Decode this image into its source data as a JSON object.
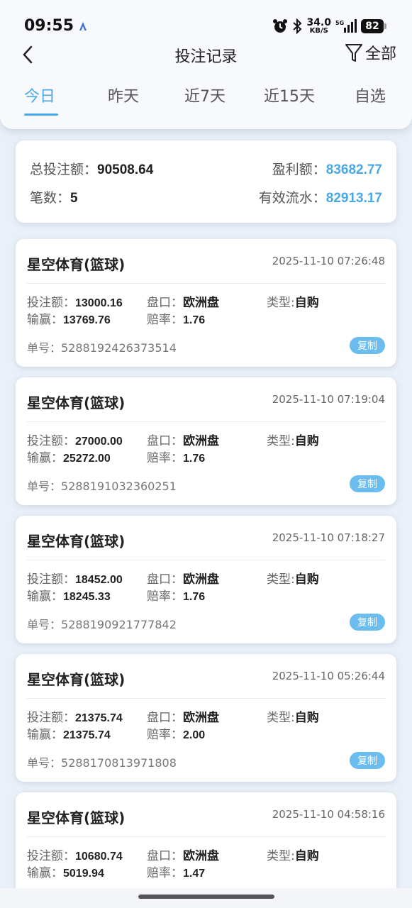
{
  "status_bar": {
    "time": "09:55",
    "net_speed": "34.0",
    "net_unit": "KB/S",
    "battery": "82"
  },
  "nav": {
    "title": "投注记录",
    "filter_label": "全部"
  },
  "tabs": [
    {
      "label": "今日",
      "active": true
    },
    {
      "label": "昨天",
      "active": false
    },
    {
      "label": "近7天",
      "active": false
    },
    {
      "label": "近15天",
      "active": false
    },
    {
      "label": "自选",
      "active": false
    }
  ],
  "summary": {
    "total_bet_label": "总投注额：",
    "total_bet": "90508.64",
    "profit_label": "盈利额：",
    "profit": "83682.77",
    "count_label": "笔数：",
    "count": "5",
    "turnover_label": "有效流水：",
    "turnover": "82913.17"
  },
  "labels": {
    "bet": "投注额：",
    "win": "输赢：",
    "market": "盘口：",
    "odds": "赔率：",
    "type": "类型:",
    "order_no": "单号：",
    "copy": "复制"
  },
  "colors": {
    "accent": "#4aa8e8",
    "copy_button": "#6bbdf0",
    "background": "#eaf0f8"
  },
  "records": [
    {
      "title": "星空体育(篮球)",
      "time": "2025-11-10 07:26:48",
      "bet": "13000.16",
      "win": "13769.76",
      "market": "欧洲盘",
      "odds": "1.76",
      "type": "自购",
      "order_no": "5288192426373514"
    },
    {
      "title": "星空体育(篮球)",
      "time": "2025-11-10 07:19:04",
      "bet": "27000.00",
      "win": "25272.00",
      "market": "欧洲盘",
      "odds": "1.76",
      "type": "自购",
      "order_no": "5288191032360251"
    },
    {
      "title": "星空体育(篮球)",
      "time": "2025-11-10 07:18:27",
      "bet": "18452.00",
      "win": "18245.33",
      "market": "欧洲盘",
      "odds": "1.76",
      "type": "自购",
      "order_no": "5288190921777842"
    },
    {
      "title": "星空体育(篮球)",
      "time": "2025-11-10 05:26:44",
      "bet": "21375.74",
      "win": "21375.74",
      "market": "欧洲盘",
      "odds": "2.00",
      "type": "自购",
      "order_no": "5288170813971808"
    },
    {
      "title": "星空体育(篮球)",
      "time": "2025-11-10 04:58:16",
      "bet": "10680.74",
      "win": "5019.94",
      "market": "欧洲盘",
      "odds": "1.47",
      "type": "自购",
      "order_no": ""
    }
  ]
}
